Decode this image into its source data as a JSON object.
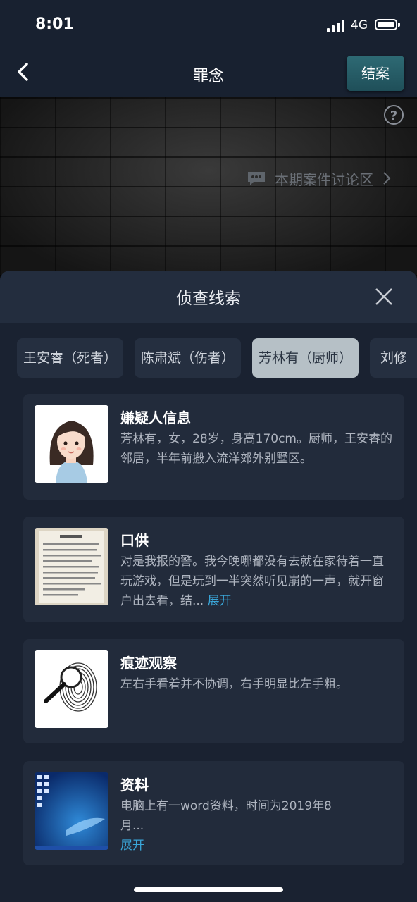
{
  "status_bar": {
    "time": "8:01",
    "network": "4G"
  },
  "nav": {
    "title": "罪念",
    "close_case_label": "结案",
    "help_symbol": "?"
  },
  "discussion": {
    "label": "本期案件讨论区"
  },
  "sheet": {
    "title": "侦查线索",
    "tabs": [
      {
        "label": "王安睿（死者）"
      },
      {
        "label": "陈肃斌（伤者）"
      },
      {
        "label": "芳林有（厨师）",
        "active": true
      },
      {
        "label": "刘修"
      }
    ],
    "clues": [
      {
        "title": "嫌疑人信息",
        "text": "芳林有，女，28岁，身高170cm。厨师，王安睿的邻居，半年前搬入流洋郊外别墅区。",
        "expand": ""
      },
      {
        "title": "口供",
        "text": "对是我报的警。我今晚哪都没有去就在家待着一直玩游戏，但是玩到一半突然听见崩的一声，就开窗户出去看，结...",
        "expand": "展开"
      },
      {
        "title": "痕迹观察",
        "text": "左右手看着并不协调，右手明显比左手粗。",
        "expand": ""
      },
      {
        "title": "资料",
        "text": "电脑上有一word资料，时间为2019年8月...",
        "expand": "展开"
      }
    ]
  },
  "colors": {
    "accent": "#3aa6d8",
    "active_tab": "#b6c0c6",
    "button": "#2e6a74"
  },
  "icons": [
    "back-icon",
    "help-icon",
    "chat-icon",
    "chevron-right-icon",
    "close-icon"
  ]
}
